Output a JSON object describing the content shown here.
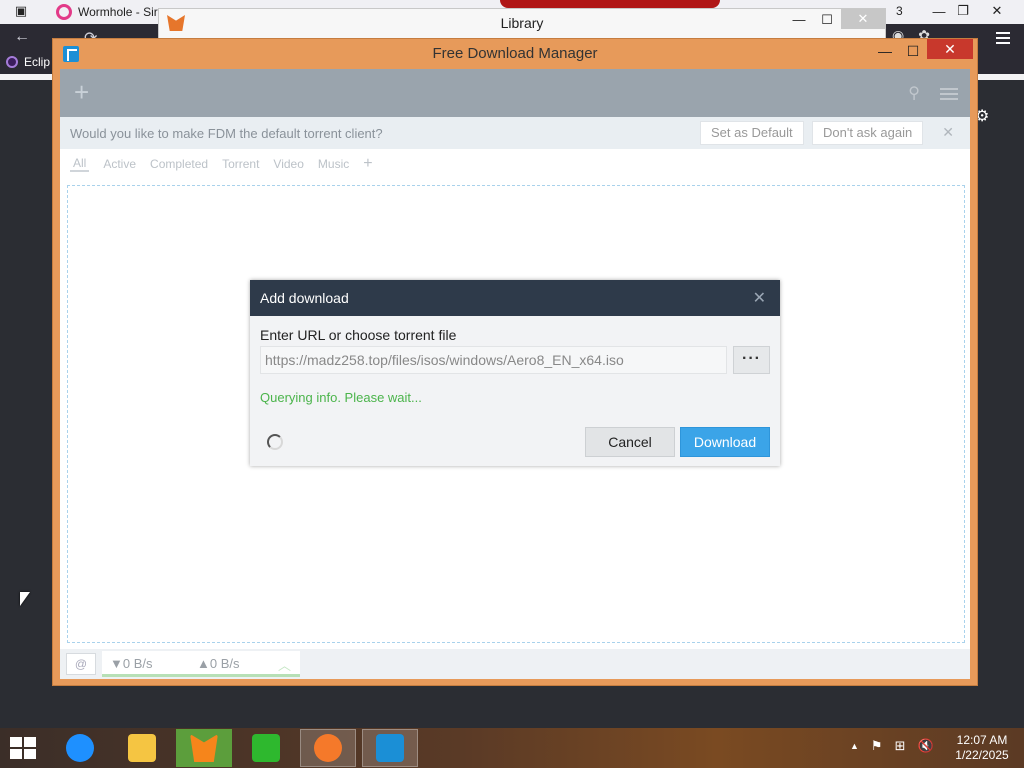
{
  "browser": {
    "tab_title": "Wormhole - Sir",
    "tab_count": "3",
    "bookmark": "Eclip"
  },
  "library": {
    "title": "Library",
    "minimize": "—",
    "maximize": "☐",
    "close": "✕"
  },
  "fdm": {
    "title": "Free Download Manager",
    "minimize": "—",
    "maximize": "☐",
    "close": "✕",
    "toolbar": {
      "add": "+"
    },
    "notification": {
      "text": "Would you like to make FDM the default torrent client?",
      "set_default": "Set as Default",
      "dont_ask": "Don't ask again",
      "close": "✕"
    },
    "filters": [
      "All",
      "Active",
      "Completed",
      "Torrent",
      "Video",
      "Music"
    ],
    "add_filter": "+",
    "status": {
      "download_speed": "▼0 B/s",
      "upload_speed": "▲0 B/s",
      "chevron": "︿"
    }
  },
  "dialog": {
    "title": "Add download",
    "close": "✕",
    "label": "Enter URL or choose torrent file",
    "url_value": "https://madz258.top/files/isos/windows/Aero8_EN_x64.iso",
    "browse": "···",
    "status": "Querying info. Please wait...",
    "cancel": "Cancel",
    "download": "Download"
  },
  "taskbar": {
    "time": "12:07 AM",
    "date": "1/22/2025",
    "tray_arrow": "▲",
    "colors": {
      "ie": "#1e90ff",
      "explorer": "#f5c542",
      "metamask": "#f6851b",
      "store": "#2eb82e",
      "blender": "#f5792a",
      "fdm": "#1b8fd6"
    }
  }
}
